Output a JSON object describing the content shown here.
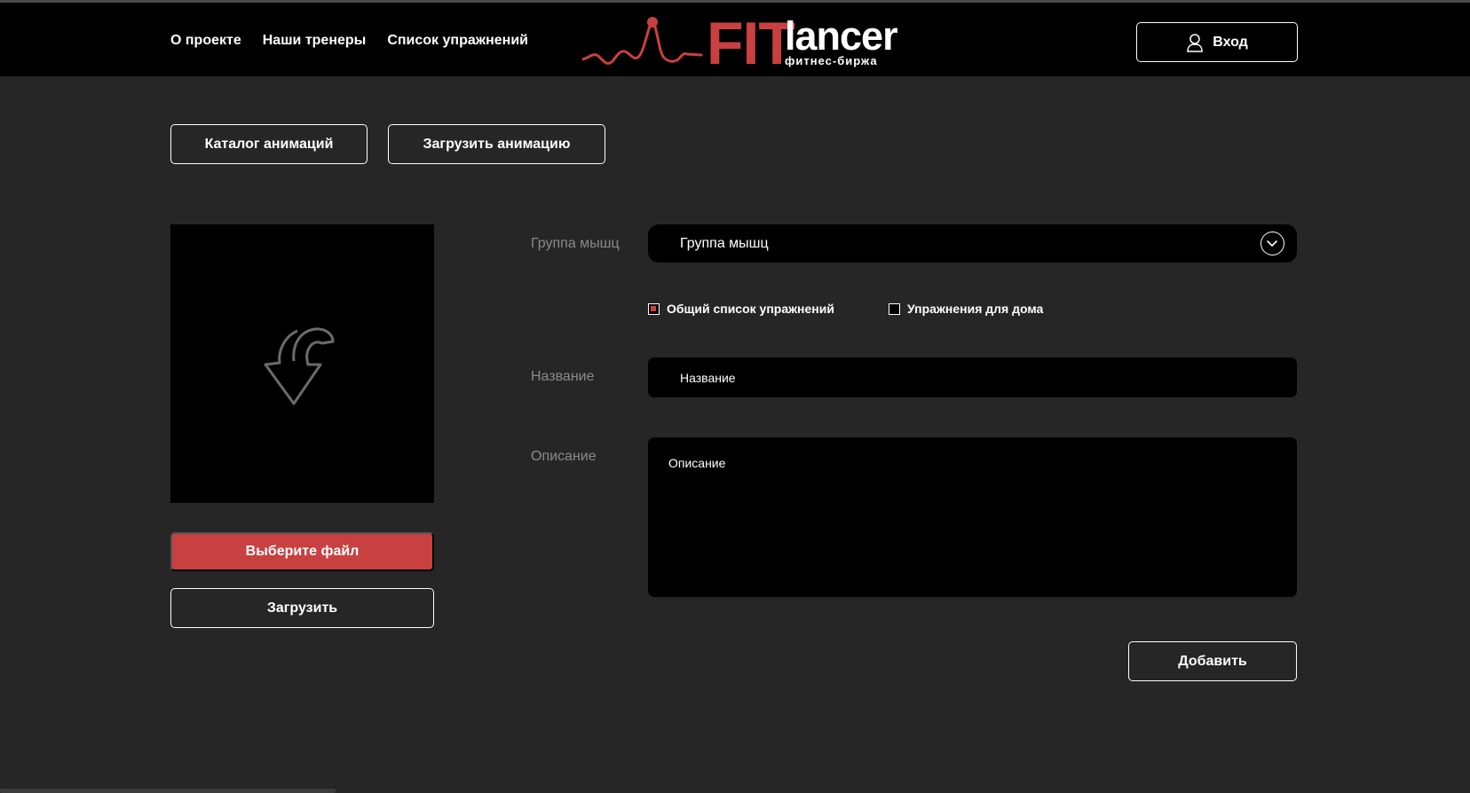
{
  "header": {
    "nav": [
      "О проекте",
      "Наши тренеры",
      "Список упражнений"
    ],
    "logo": {
      "brand_accent": "FIT",
      "brand_main": "lancer",
      "tagline": "фитнес-биржа",
      "accent_color": "#c94040"
    },
    "login_label": "Вход",
    "login_icon": "user-icon"
  },
  "tabs": {
    "catalog": "Каталог анимаций",
    "upload": "Загрузить анимацию"
  },
  "upload_panel": {
    "preview_icon": "upload-arrow-icon",
    "choose_file": "Выберите файл",
    "upload": "Загрузить"
  },
  "form": {
    "muscle_group_label": "Группа мышц",
    "muscle_group_value": "Группа мышц",
    "checkboxes": [
      {
        "label": "Общий список упражнений",
        "checked": true
      },
      {
        "label": "Упражнения для дома",
        "checked": false
      }
    ],
    "name_label": "Название",
    "name_placeholder": "Название",
    "description_label": "Описание",
    "description_placeholder": "Описание",
    "submit": "Добавить"
  }
}
